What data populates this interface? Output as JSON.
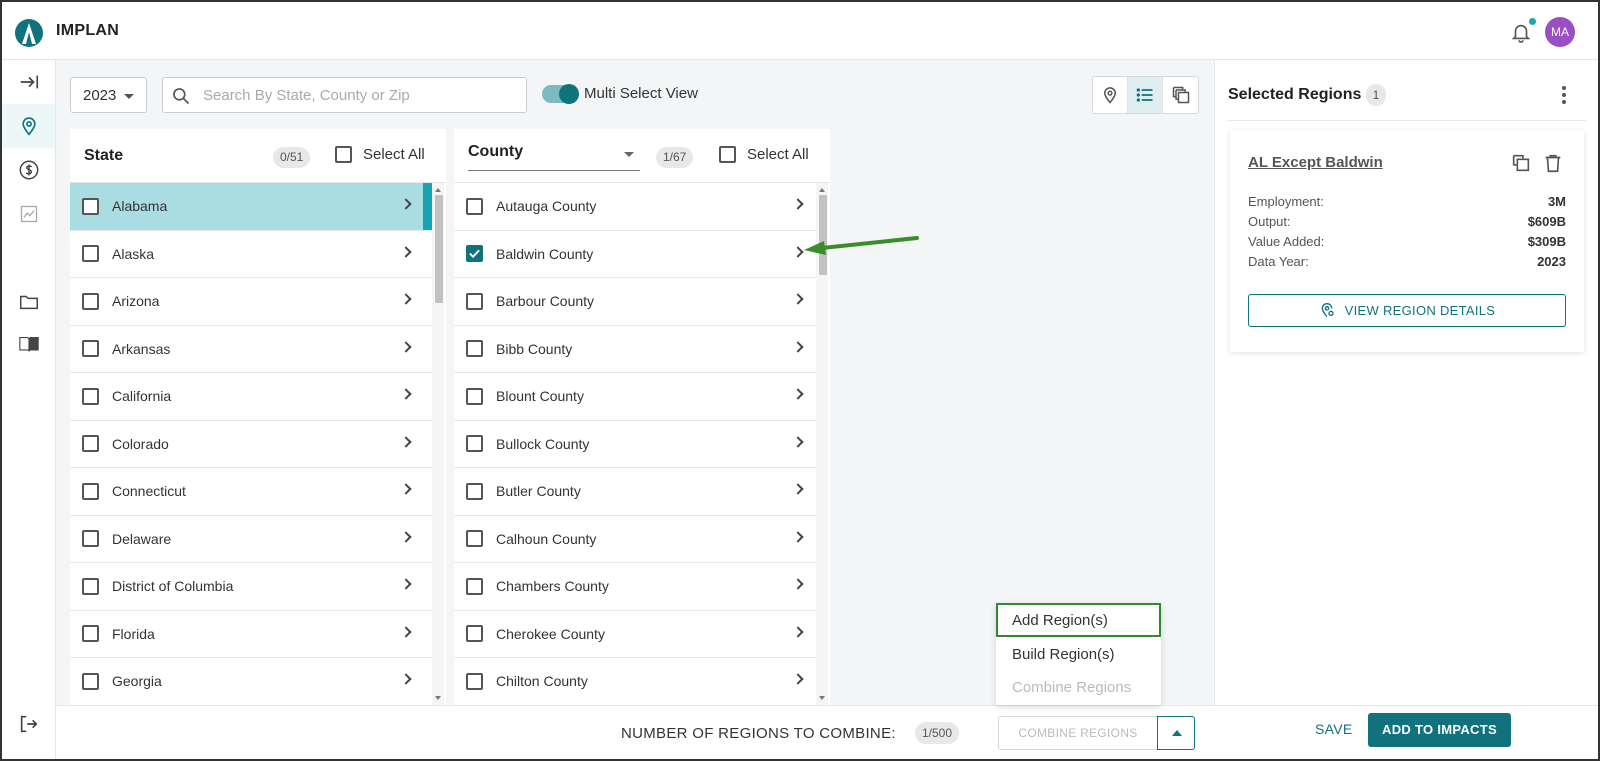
{
  "app": {
    "name": "IMPLAN",
    "user_initials": "MA"
  },
  "colors": {
    "primary": "#10727c",
    "accent": "#17a3b0",
    "selected_row": "#aadde2",
    "avatar": "#9b4fc4",
    "highlight_border": "#2e8b2e"
  },
  "rail": {
    "icons": [
      "expand-icon",
      "map-pin-icon",
      "dollar-icon",
      "chart-icon",
      "folder-icon",
      "book-icon",
      "logout-icon"
    ],
    "active": "map-pin-icon"
  },
  "toolbar": {
    "year": "2023",
    "search_placeholder": "Search By State, County or Zip",
    "multi_select_label": "Multi Select View",
    "multi_select_on": true
  },
  "state_panel": {
    "title": "State",
    "count": "0/51",
    "select_all": "Select All",
    "items": [
      {
        "label": "Alabama",
        "selected": true
      },
      {
        "label": "Alaska"
      },
      {
        "label": "Arizona"
      },
      {
        "label": "Arkansas"
      },
      {
        "label": "California"
      },
      {
        "label": "Colorado"
      },
      {
        "label": "Connecticut"
      },
      {
        "label": "Delaware"
      },
      {
        "label": "District of Columbia"
      },
      {
        "label": "Florida"
      },
      {
        "label": "Georgia"
      }
    ]
  },
  "county_panel": {
    "title": "County",
    "count": "1/67",
    "select_all": "Select All",
    "items": [
      {
        "label": "Autauga County"
      },
      {
        "label": "Baldwin County",
        "checked": true
      },
      {
        "label": "Barbour County"
      },
      {
        "label": "Bibb County"
      },
      {
        "label": "Blount County"
      },
      {
        "label": "Bullock County"
      },
      {
        "label": "Butler County"
      },
      {
        "label": "Calhoun County"
      },
      {
        "label": "Chambers County"
      },
      {
        "label": "Cherokee County"
      },
      {
        "label": "Chilton County"
      }
    ]
  },
  "menu": {
    "items": [
      {
        "label": "Add Region(s)",
        "highlighted": true
      },
      {
        "label": "Build Region(s)"
      },
      {
        "label": "Combine Regions",
        "disabled": true
      }
    ]
  },
  "bottom": {
    "combine_label": "NUMBER OF REGIONS TO COMBINE:",
    "combine_count": "1/500",
    "combine_button": "COMBINE REGIONS",
    "save": "SAVE",
    "add_to_impacts": "ADD TO IMPACTS"
  },
  "selected": {
    "title": "Selected Regions",
    "count": "1",
    "region": {
      "name": "AL Except Baldwin",
      "stats": [
        {
          "label": "Employment:",
          "value": "3M"
        },
        {
          "label": "Output:",
          "value": "$609B"
        },
        {
          "label": "Value Added:",
          "value": "$309B"
        },
        {
          "label": "Data Year:",
          "value": "2023"
        }
      ],
      "view_details": "VIEW REGION DETAILS"
    }
  }
}
